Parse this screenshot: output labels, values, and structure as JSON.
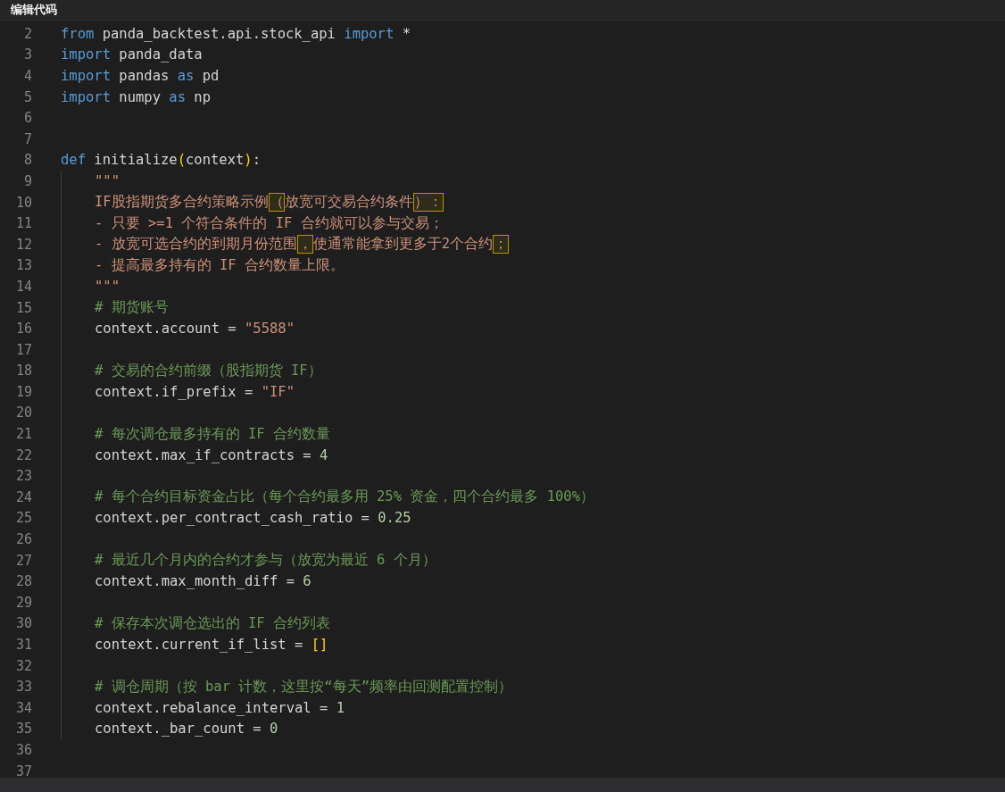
{
  "window": {
    "title": "编辑代码"
  },
  "editor": {
    "lines": [
      {
        "number": "2",
        "tokens": [
          {
            "kind": "keyword",
            "text": "from"
          },
          {
            "kind": "plain",
            "text": " panda_backtest.api.stock_api "
          },
          {
            "kind": "keyword",
            "text": "import"
          },
          {
            "kind": "plain",
            "text": " *"
          }
        ]
      },
      {
        "number": "3",
        "tokens": [
          {
            "kind": "keyword",
            "text": "import"
          },
          {
            "kind": "plain",
            "text": " panda_data"
          }
        ]
      },
      {
        "number": "4",
        "tokens": [
          {
            "kind": "keyword",
            "text": "import"
          },
          {
            "kind": "plain",
            "text": " pandas "
          },
          {
            "kind": "keyword",
            "text": "as"
          },
          {
            "kind": "plain",
            "text": " pd"
          }
        ]
      },
      {
        "number": "5",
        "tokens": [
          {
            "kind": "keyword",
            "text": "import"
          },
          {
            "kind": "plain",
            "text": " numpy "
          },
          {
            "kind": "keyword",
            "text": "as"
          },
          {
            "kind": "plain",
            "text": " np"
          }
        ]
      },
      {
        "number": "6"
      },
      {
        "number": "7"
      },
      {
        "number": "8",
        "tokens": [
          {
            "kind": "keyword",
            "text": "def"
          },
          {
            "kind": "plain",
            "text": " initialize"
          },
          {
            "kind": "bracket",
            "text": "("
          },
          {
            "kind": "plain",
            "text": "context"
          },
          {
            "kind": "bracket",
            "text": ")"
          },
          {
            "kind": "plain",
            "text": ":"
          }
        ],
        "children": [
          {
            "number": "9",
            "tokens": [
              {
                "kind": "string",
                "text": "\"\"\""
              }
            ]
          },
          {
            "number": "10",
            "tokens": [
              {
                "kind": "string",
                "text": "IF股指期货多合约策略示例"
              },
              {
                "kind": "flagged",
                "text": "（"
              },
              {
                "kind": "string",
                "text": "放宽可交易合约条件"
              },
              {
                "kind": "flagged",
                "text": "）："
              }
            ]
          },
          {
            "number": "11",
            "tokens": [
              {
                "kind": "string",
                "text": "- 只要 >=1 个符合条件的 IF 合约就可以参与交易；"
              }
            ]
          },
          {
            "number": "12",
            "tokens": [
              {
                "kind": "string",
                "text": "- 放宽可选合约的到期月份范围"
              },
              {
                "kind": "flagged",
                "text": "，"
              },
              {
                "kind": "string",
                "text": "使通常能拿到更多于2个合约"
              },
              {
                "kind": "flagged",
                "text": "；"
              }
            ]
          },
          {
            "number": "13",
            "tokens": [
              {
                "kind": "string",
                "text": "- 提高最多持有的 IF 合约数量上限。"
              }
            ]
          },
          {
            "number": "14",
            "tokens": [
              {
                "kind": "string",
                "text": "\"\"\""
              }
            ]
          },
          {
            "number": "15",
            "tokens": [
              {
                "kind": "comment",
                "text": "# 期货账号"
              }
            ]
          },
          {
            "number": "16",
            "tokens": [
              {
                "kind": "plain",
                "text": "context.account = "
              },
              {
                "kind": "string",
                "text": "\"5588\""
              }
            ]
          },
          {
            "number": "17"
          },
          {
            "number": "18",
            "tokens": [
              {
                "kind": "comment",
                "text": "# 交易的合约前缀（股指期货 IF）"
              }
            ]
          },
          {
            "number": "19",
            "tokens": [
              {
                "kind": "plain",
                "text": "context.if_prefix = "
              },
              {
                "kind": "string",
                "text": "\"IF\""
              }
            ]
          },
          {
            "number": "20"
          },
          {
            "number": "21",
            "tokens": [
              {
                "kind": "comment",
                "text": "# 每次调仓最多持有的 IF 合约数量"
              }
            ]
          },
          {
            "number": "22",
            "tokens": [
              {
                "kind": "plain",
                "text": "context.max_if_contracts = "
              },
              {
                "kind": "number",
                "text": "4"
              }
            ]
          },
          {
            "number": "23"
          },
          {
            "number": "24",
            "tokens": [
              {
                "kind": "comment",
                "text": "# 每个合约目标资金占比（每个合约最多用 25% 资金，四个合约最多 100%）"
              }
            ]
          },
          {
            "number": "25",
            "tokens": [
              {
                "kind": "plain",
                "text": "context.per_contract_cash_ratio = "
              },
              {
                "kind": "number",
                "text": "0.25"
              }
            ]
          },
          {
            "number": "26"
          },
          {
            "number": "27",
            "tokens": [
              {
                "kind": "comment",
                "text": "# 最近几个月内的合约才参与（放宽为最近 6 个月）"
              }
            ]
          },
          {
            "number": "28",
            "tokens": [
              {
                "kind": "plain",
                "text": "context.max_month_diff = "
              },
              {
                "kind": "number",
                "text": "6"
              }
            ]
          },
          {
            "number": "29"
          },
          {
            "number": "30",
            "tokens": [
              {
                "kind": "comment",
                "text": "# 保存本次调仓选出的 IF 合约列表"
              }
            ]
          },
          {
            "number": "31",
            "tokens": [
              {
                "kind": "plain",
                "text": "context.current_if_list = "
              },
              {
                "kind": "bracket",
                "text": "[]"
              }
            ]
          },
          {
            "number": "32"
          },
          {
            "number": "33",
            "tokens": [
              {
                "kind": "comment",
                "text": "# 调仓周期（按 bar 计数，这里按“每天”频率由回测配置控制）"
              }
            ]
          },
          {
            "number": "34",
            "tokens": [
              {
                "kind": "plain",
                "text": "context.rebalance_interval = "
              },
              {
                "kind": "number",
                "text": "1"
              }
            ]
          },
          {
            "number": "35",
            "tokens": [
              {
                "kind": "plain",
                "text": "context._bar_count = "
              },
              {
                "kind": "number",
                "text": "0"
              }
            ]
          }
        ]
      },
      {
        "number": "36"
      },
      {
        "number": "37"
      }
    ]
  }
}
